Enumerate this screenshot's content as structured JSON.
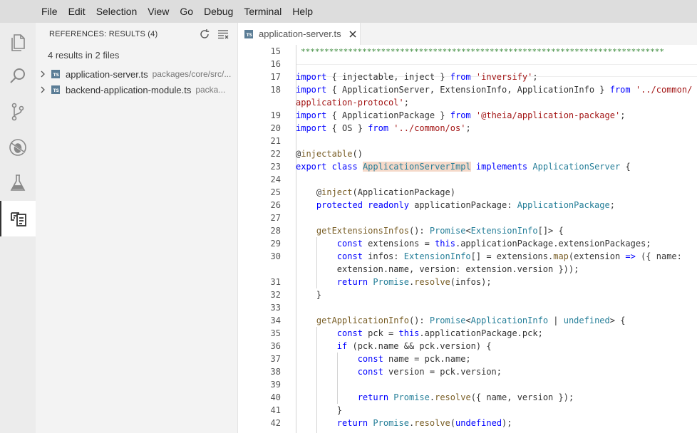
{
  "menu": [
    "File",
    "Edit",
    "Selection",
    "View",
    "Go",
    "Debug",
    "Terminal",
    "Help"
  ],
  "activity_bar": [
    {
      "name": "explorer-icon",
      "active": false
    },
    {
      "name": "search-icon",
      "active": false
    },
    {
      "name": "source-control-icon",
      "active": false
    },
    {
      "name": "debug-icon",
      "active": false
    },
    {
      "name": "test-flask-icon",
      "active": false
    },
    {
      "name": "references-icon",
      "active": true
    }
  ],
  "panel": {
    "title": "REFERENCES: RESULTS (4)",
    "summary": "4 results in 2 files",
    "files": [
      {
        "name": "application-server.ts",
        "path": "packages/core/src/..."
      },
      {
        "name": "backend-application-module.ts",
        "path": "packa..."
      }
    ]
  },
  "tab": {
    "label": "application-server.ts",
    "icon_text": "TS"
  },
  "editor": {
    "stars": "*****************************************************************************",
    "lines": [
      {
        "n": "15",
        "segs": []
      },
      {
        "n": "16",
        "segs": []
      },
      {
        "n": "17",
        "segs": [
          [
            "kw",
            "import"
          ],
          [
            "",
            " { injectable, inject } "
          ],
          [
            "kw",
            "from"
          ],
          [
            "",
            " "
          ],
          [
            "str",
            "'inversify'"
          ],
          [
            "",
            ";"
          ]
        ]
      },
      {
        "n": "18",
        "segs": [
          [
            "kw",
            "import"
          ],
          [
            "",
            " { ApplicationServer, ExtensionInfo, ApplicationInfo } "
          ],
          [
            "kw",
            "from"
          ],
          [
            "",
            " "
          ],
          [
            "str",
            "'../common/"
          ]
        ]
      },
      {
        "n": "",
        "segs": [
          [
            "str",
            "application-protocol'"
          ],
          [
            "",
            ";"
          ]
        ]
      },
      {
        "n": "19",
        "segs": [
          [
            "kw",
            "import"
          ],
          [
            "",
            " { ApplicationPackage } "
          ],
          [
            "kw",
            "from"
          ],
          [
            "",
            " "
          ],
          [
            "str",
            "'@theia/application-package'"
          ],
          [
            "",
            ";"
          ]
        ]
      },
      {
        "n": "20",
        "segs": [
          [
            "kw",
            "import"
          ],
          [
            "",
            " { OS } "
          ],
          [
            "kw",
            "from"
          ],
          [
            "",
            " "
          ],
          [
            "str",
            "'../common/os'"
          ],
          [
            "",
            ";"
          ]
        ]
      },
      {
        "n": "21",
        "segs": []
      },
      {
        "n": "22",
        "segs": [
          [
            "",
            "@"
          ],
          [
            "dec",
            "injectable"
          ],
          [
            "",
            "()"
          ]
        ]
      },
      {
        "n": "23",
        "segs": [
          [
            "kw",
            "export"
          ],
          [
            "",
            " "
          ],
          [
            "kw",
            "class"
          ],
          [
            "",
            " "
          ],
          [
            "hl ty",
            "ApplicationServerImpl"
          ],
          [
            "",
            " "
          ],
          [
            "kw",
            "implements"
          ],
          [
            "",
            " "
          ],
          [
            "ty",
            "ApplicationServer"
          ],
          [
            "",
            " {"
          ]
        ]
      },
      {
        "n": "24",
        "segs": []
      },
      {
        "n": "25",
        "segs": [
          [
            "",
            "    @"
          ],
          [
            "dec",
            "inject"
          ],
          [
            "",
            "(ApplicationPackage)"
          ]
        ]
      },
      {
        "n": "26",
        "segs": [
          [
            "",
            "    "
          ],
          [
            "kw",
            "protected"
          ],
          [
            "",
            " "
          ],
          [
            "kw",
            "readonly"
          ],
          [
            "",
            " applicationPackage: "
          ],
          [
            "ty",
            "ApplicationPackage"
          ],
          [
            "",
            ";"
          ]
        ]
      },
      {
        "n": "27",
        "segs": []
      },
      {
        "n": "28",
        "segs": [
          [
            "",
            "    "
          ],
          [
            "dec",
            "getExtensionsInfos"
          ],
          [
            "",
            "(): "
          ],
          [
            "ty",
            "Promise"
          ],
          [
            "",
            "<"
          ],
          [
            "ty",
            "ExtensionInfo"
          ],
          [
            "",
            "[]> {"
          ]
        ]
      },
      {
        "n": "29",
        "segs": [
          [
            "",
            "        "
          ],
          [
            "kw",
            "const"
          ],
          [
            "",
            " extensions = "
          ],
          [
            "kw",
            "this"
          ],
          [
            "",
            ".applicationPackage.extensionPackages;"
          ]
        ]
      },
      {
        "n": "30",
        "segs": [
          [
            "",
            "        "
          ],
          [
            "kw",
            "const"
          ],
          [
            "",
            " infos: "
          ],
          [
            "ty",
            "ExtensionInfo"
          ],
          [
            "",
            "[] = extensions."
          ],
          [
            "dec",
            "map"
          ],
          [
            "",
            "(extension "
          ],
          [
            "kw",
            "=>"
          ],
          [
            "",
            " ({ name:"
          ]
        ]
      },
      {
        "n": "",
        "segs": [
          [
            "",
            "        extension.name, version: extension.version }));"
          ]
        ]
      },
      {
        "n": "31",
        "segs": [
          [
            "",
            "        "
          ],
          [
            "kw",
            "return"
          ],
          [
            "",
            " "
          ],
          [
            "ty",
            "Promise"
          ],
          [
            "",
            "."
          ],
          [
            "dec",
            "resolve"
          ],
          [
            "",
            "(infos);"
          ]
        ]
      },
      {
        "n": "32",
        "segs": [
          [
            "",
            "    }"
          ]
        ]
      },
      {
        "n": "33",
        "segs": []
      },
      {
        "n": "34",
        "segs": [
          [
            "",
            "    "
          ],
          [
            "dec",
            "getApplicationInfo"
          ],
          [
            "",
            "(): "
          ],
          [
            "ty",
            "Promise"
          ],
          [
            "",
            "<"
          ],
          [
            "ty",
            "ApplicationInfo"
          ],
          [
            "",
            " | "
          ],
          [
            "ty",
            "undefined"
          ],
          [
            "",
            "> {"
          ]
        ]
      },
      {
        "n": "35",
        "segs": [
          [
            "",
            "        "
          ],
          [
            "kw",
            "const"
          ],
          [
            "",
            " pck = "
          ],
          [
            "kw",
            "this"
          ],
          [
            "",
            ".applicationPackage.pck;"
          ]
        ]
      },
      {
        "n": "36",
        "segs": [
          [
            "",
            "        "
          ],
          [
            "kw",
            "if"
          ],
          [
            "",
            " (pck.name && pck.version) {"
          ]
        ]
      },
      {
        "n": "37",
        "segs": [
          [
            "",
            "            "
          ],
          [
            "kw",
            "const"
          ],
          [
            "",
            " name = pck.name;"
          ]
        ]
      },
      {
        "n": "38",
        "segs": [
          [
            "",
            "            "
          ],
          [
            "kw",
            "const"
          ],
          [
            "",
            " version = pck.version;"
          ]
        ]
      },
      {
        "n": "39",
        "segs": []
      },
      {
        "n": "40",
        "segs": [
          [
            "",
            "            "
          ],
          [
            "kw",
            "return"
          ],
          [
            "",
            " "
          ],
          [
            "ty",
            "Promise"
          ],
          [
            "",
            "."
          ],
          [
            "dec",
            "resolve"
          ],
          [
            "",
            "({ name, version });"
          ]
        ]
      },
      {
        "n": "41",
        "segs": [
          [
            "",
            "        }"
          ]
        ]
      },
      {
        "n": "42",
        "segs": [
          [
            "",
            "        "
          ],
          [
            "kw",
            "return"
          ],
          [
            "",
            " "
          ],
          [
            "ty",
            "Promise"
          ],
          [
            "",
            "."
          ],
          [
            "dec",
            "resolve"
          ],
          [
            "",
            "("
          ],
          [
            "kw",
            "undefined"
          ],
          [
            "",
            ");"
          ]
        ]
      }
    ]
  }
}
